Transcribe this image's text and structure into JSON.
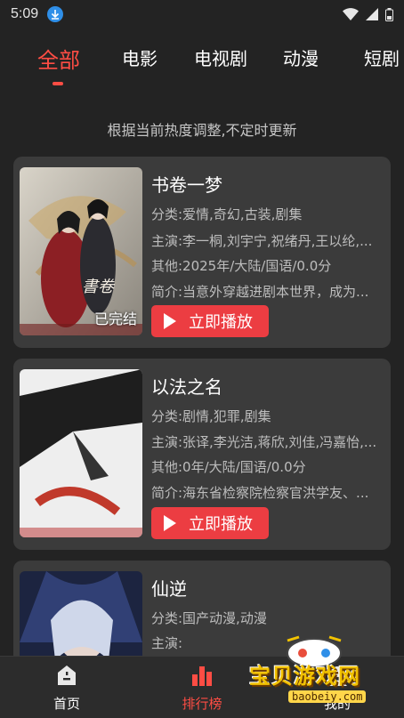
{
  "status": {
    "time": "5:09"
  },
  "tabs": [
    {
      "label": "全部",
      "active": true
    },
    {
      "label": "电影"
    },
    {
      "label": "电视剧"
    },
    {
      "label": "动漫"
    },
    {
      "label": "短剧"
    }
  ],
  "subtitle": "根据当前热度调整,不定时更新",
  "cards": [
    {
      "title": "书卷一梦",
      "genre": "分类:爱情,奇幻,古装,剧集",
      "cast": "主演:李一桐,刘宇宁,祝绪丹,王以纶,...",
      "other": "其他:2025年/大陆/国语/0.0分",
      "intro": "简介:当意外穿越进剧本世界，成为...",
      "badge": "已完结",
      "play": "立即播放"
    },
    {
      "title": "以法之名",
      "genre": "分类:剧情,犯罪,剧集",
      "cast": "主演:张译,李光洁,蒋欣,刘佳,冯嘉怡,...",
      "other": "其他:0年/大陆/国语/0.0分",
      "intro": "简介:海东省检察院检察官洪学友、...",
      "badge": "",
      "play": "立即播放"
    },
    {
      "title": "仙逆",
      "genre": "分类:国产动漫,动漫",
      "cast": "主演:",
      "other": "",
      "intro": "",
      "badge": "",
      "play": ""
    }
  ],
  "nav": [
    {
      "label": "首页",
      "icon": "home-icon",
      "active": false
    },
    {
      "label": "排行榜",
      "icon": "rank-icon",
      "active": true
    },
    {
      "label": "我的",
      "icon": "profile-icon",
      "active": false
    }
  ],
  "watermark": {
    "text": "宝贝游戏网",
    "url": "baobeiy.com"
  },
  "colors": {
    "accent": "#ff4d44",
    "play": "#ec3d42",
    "background": "#232323",
    "card": "#3b3b3b"
  }
}
